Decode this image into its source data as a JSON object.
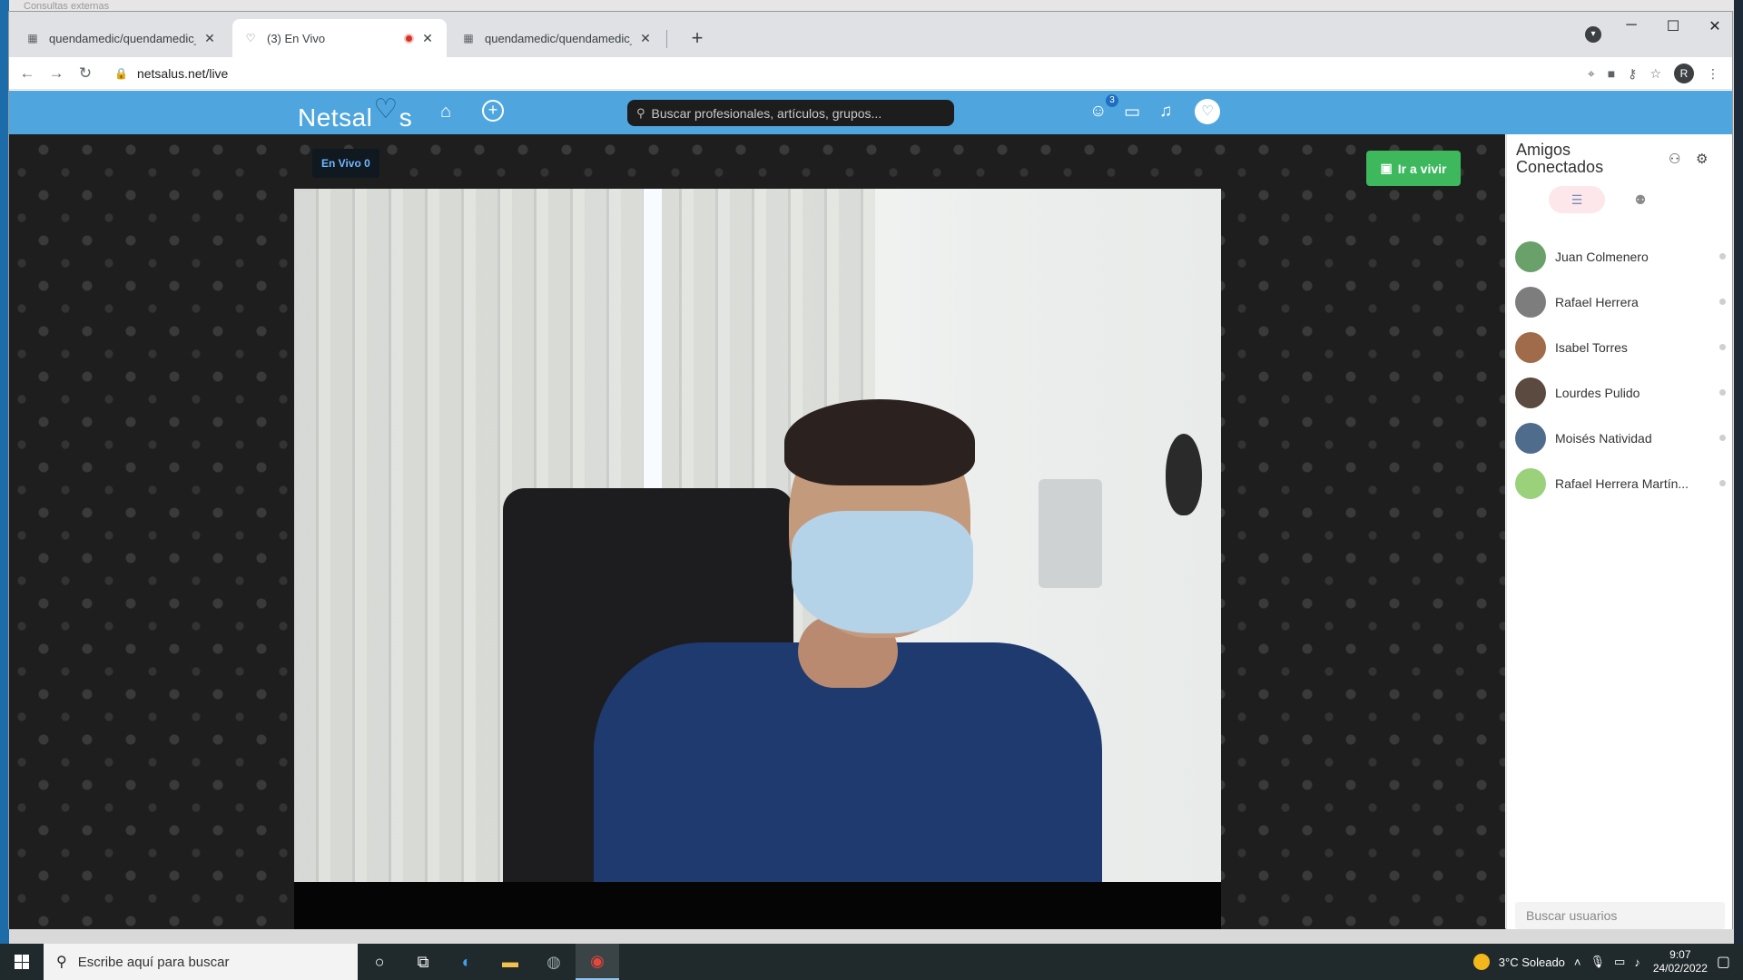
{
  "desktop": {
    "title_fragment": "Consultas externas"
  },
  "browser": {
    "tabs": [
      {
        "title": "quendamedic/quendamedic_inte",
        "active": false
      },
      {
        "title": "(3) En Vivo",
        "active": true,
        "recording": true
      },
      {
        "title": "quendamedic/quendamedic_inte",
        "active": false
      }
    ],
    "url": "netsalus.net/live",
    "profile_initial": "R"
  },
  "app": {
    "logo_left": "Netsal",
    "logo_right": "s",
    "search_placeholder": "Buscar profesionales, artículos, grupos...",
    "messages_badge": "3",
    "live_label": "En Vivo 0",
    "go_live_label": "Ir a vivir"
  },
  "panel": {
    "title": "Amigos Conectados",
    "friends": [
      {
        "name": "Juan Colmenero",
        "avatar_color": "#6aa06a"
      },
      {
        "name": "Rafael Herrera",
        "avatar_color": "#7d7d7d"
      },
      {
        "name": "Isabel Torres",
        "avatar_color": "#a06b4a"
      },
      {
        "name": "Lourdes Pulido",
        "avatar_color": "#5a4a40"
      },
      {
        "name": "Moisés Natividad",
        "avatar_color": "#4f6c8c"
      },
      {
        "name": "Rafael Herrera Martín...",
        "avatar_color": "#9bd17a"
      }
    ],
    "search_placeholder": "Buscar usuarios"
  },
  "taskbar": {
    "search_placeholder": "Escribe aquí para buscar",
    "weather": "3°C  Soleado",
    "time": "9:07",
    "date": "24/02/2022"
  }
}
